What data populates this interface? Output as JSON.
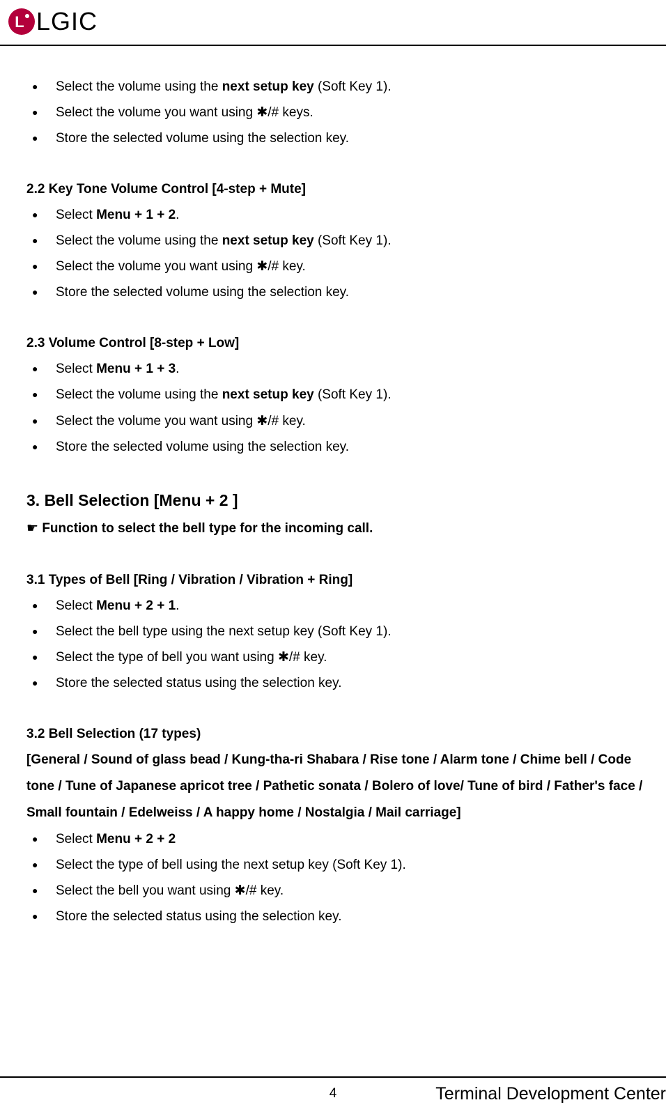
{
  "brand": "LGIC",
  "intro_bullets": [
    {
      "pre": "Select the volume using the ",
      "bold": "next setup key",
      "post": " (Soft Key 1)."
    },
    {
      "pre": "Select the volume you want using ✱/# keys.",
      "bold": "",
      "post": ""
    },
    {
      "pre": "Store the selected volume using the selection key.",
      "bold": "",
      "post": ""
    }
  ],
  "s22_title": "2.2 Key Tone Volume Control [4-step + Mute]",
  "s22_bullets": [
    {
      "pre": "Select ",
      "bold": "Menu + 1 + 2",
      "post": "."
    },
    {
      "pre": "Select the volume using the ",
      "bold": "next setup key",
      "post": " (Soft Key 1)."
    },
    {
      "pre": "Select the volume you want using ✱/# key.",
      "bold": "",
      "post": ""
    },
    {
      "pre": "Store the selected volume using the selection key.",
      "bold": "",
      "post": ""
    }
  ],
  "s23_title": "2.3 Volume Control [8-step + Low]",
  "s23_bullets": [
    {
      "pre": "Select ",
      "bold": "Menu + 1 + 3",
      "post": "."
    },
    {
      "pre": "Select the volume using the ",
      "bold": "next setup key",
      "post": " (Soft Key 1)."
    },
    {
      "pre": "Select the volume you want using ✱/# key.",
      "bold": "",
      "post": ""
    },
    {
      "pre": "Store the selected volume using the selection key.",
      "bold": "",
      "post": ""
    }
  ],
  "s3_title": "3.  Bell Selection [Menu + 2 ]",
  "s3_pointer": "☛ ",
  "s3_desc": "Function to select the bell type for the incoming call.",
  "s31_title": "3.1 Types of Bell [Ring / Vibration / Vibration + Ring]",
  "s31_bullets": [
    {
      "pre": "Select ",
      "bold": "Menu + 2 + 1",
      "post": "."
    },
    {
      "pre": "Select the bell type using the next setup key (Soft Key 1).",
      "bold": "",
      "post": ""
    },
    {
      "pre": "Select the type of bell you want using ✱/# key.",
      "bold": "",
      "post": ""
    },
    {
      "pre": "Store the selected status using the selection key.",
      "bold": "",
      "post": ""
    }
  ],
  "s32_title": "3.2 Bell Selection (17 types)",
  "s32_list": "[General / Sound of glass bead / Kung-tha-ri Shabara / Rise tone / Alarm tone / Chime bell / Code tone / Tune of Japanese apricot tree / Pathetic sonata / Bolero of love/ Tune of bird / Father's face / Small fountain / Edelweiss / A happy home / Nostalgia / Mail carriage]",
  "s32_bullets": [
    {
      "pre": "Select ",
      "bold": "Menu + 2 + 2",
      "post": ""
    },
    {
      "pre": "Select the type of bell using the next setup key (Soft Key 1).",
      "bold": "",
      "post": ""
    },
    {
      "pre": "Select the bell you want using ✱/# key.",
      "bold": "",
      "post": ""
    },
    {
      "pre": "Store the selected status using the selection key.",
      "bold": "",
      "post": ""
    }
  ],
  "page_num": "4",
  "footer": "Terminal Development Center"
}
